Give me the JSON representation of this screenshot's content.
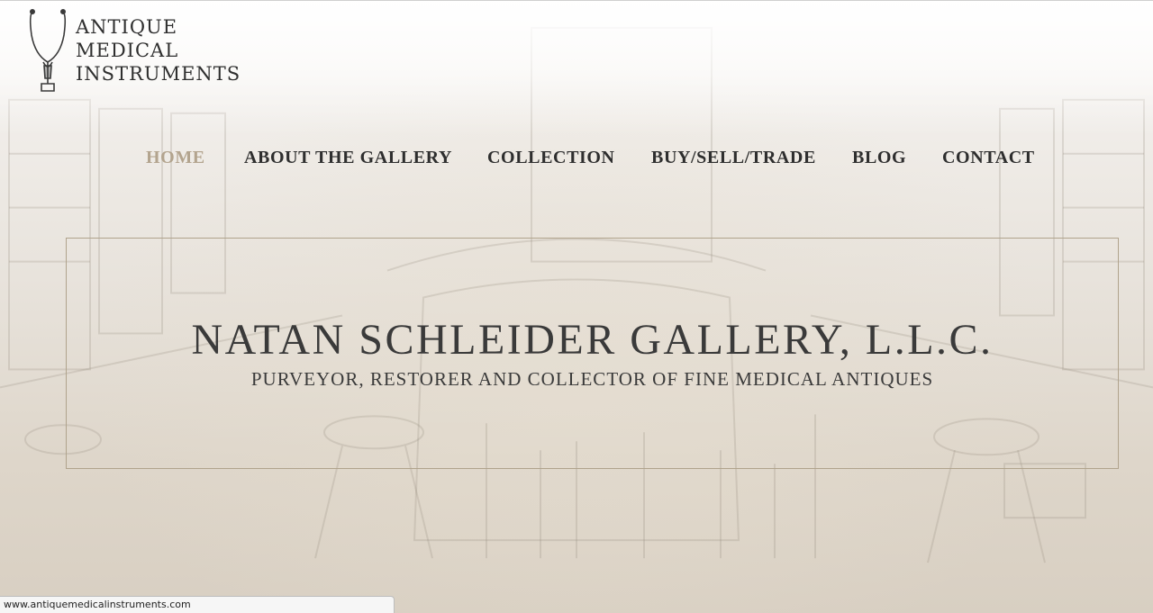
{
  "logo": {
    "line1": "ANTIQUE",
    "line2": "MEDICAL",
    "line3": "INSTRUMENTS",
    "icon": "stethoscope-icon"
  },
  "nav": {
    "items": [
      {
        "label": "HOME",
        "active": true
      },
      {
        "label": "ABOUT THE GALLERY",
        "active": false
      },
      {
        "label": "COLLECTION",
        "active": false
      },
      {
        "label": "BUY/SELL/TRADE",
        "active": false
      },
      {
        "label": "BLOG",
        "active": false
      },
      {
        "label": "CONTACT",
        "active": false
      }
    ]
  },
  "hero": {
    "title": "NATAN SCHLEIDER GALLERY, L.L.C.",
    "subtitle": "PURVEYOR, RESTORER AND COLLECTOR OF FINE MEDICAL ANTIQUES"
  },
  "status_bar": {
    "url": "www.antiquemedicalinstruments.com"
  },
  "colors": {
    "nav_text": "#2e2e2e",
    "nav_active": "#b3a48e",
    "hero_border": "#b0a38c",
    "heading_text": "#3a3a3a"
  }
}
